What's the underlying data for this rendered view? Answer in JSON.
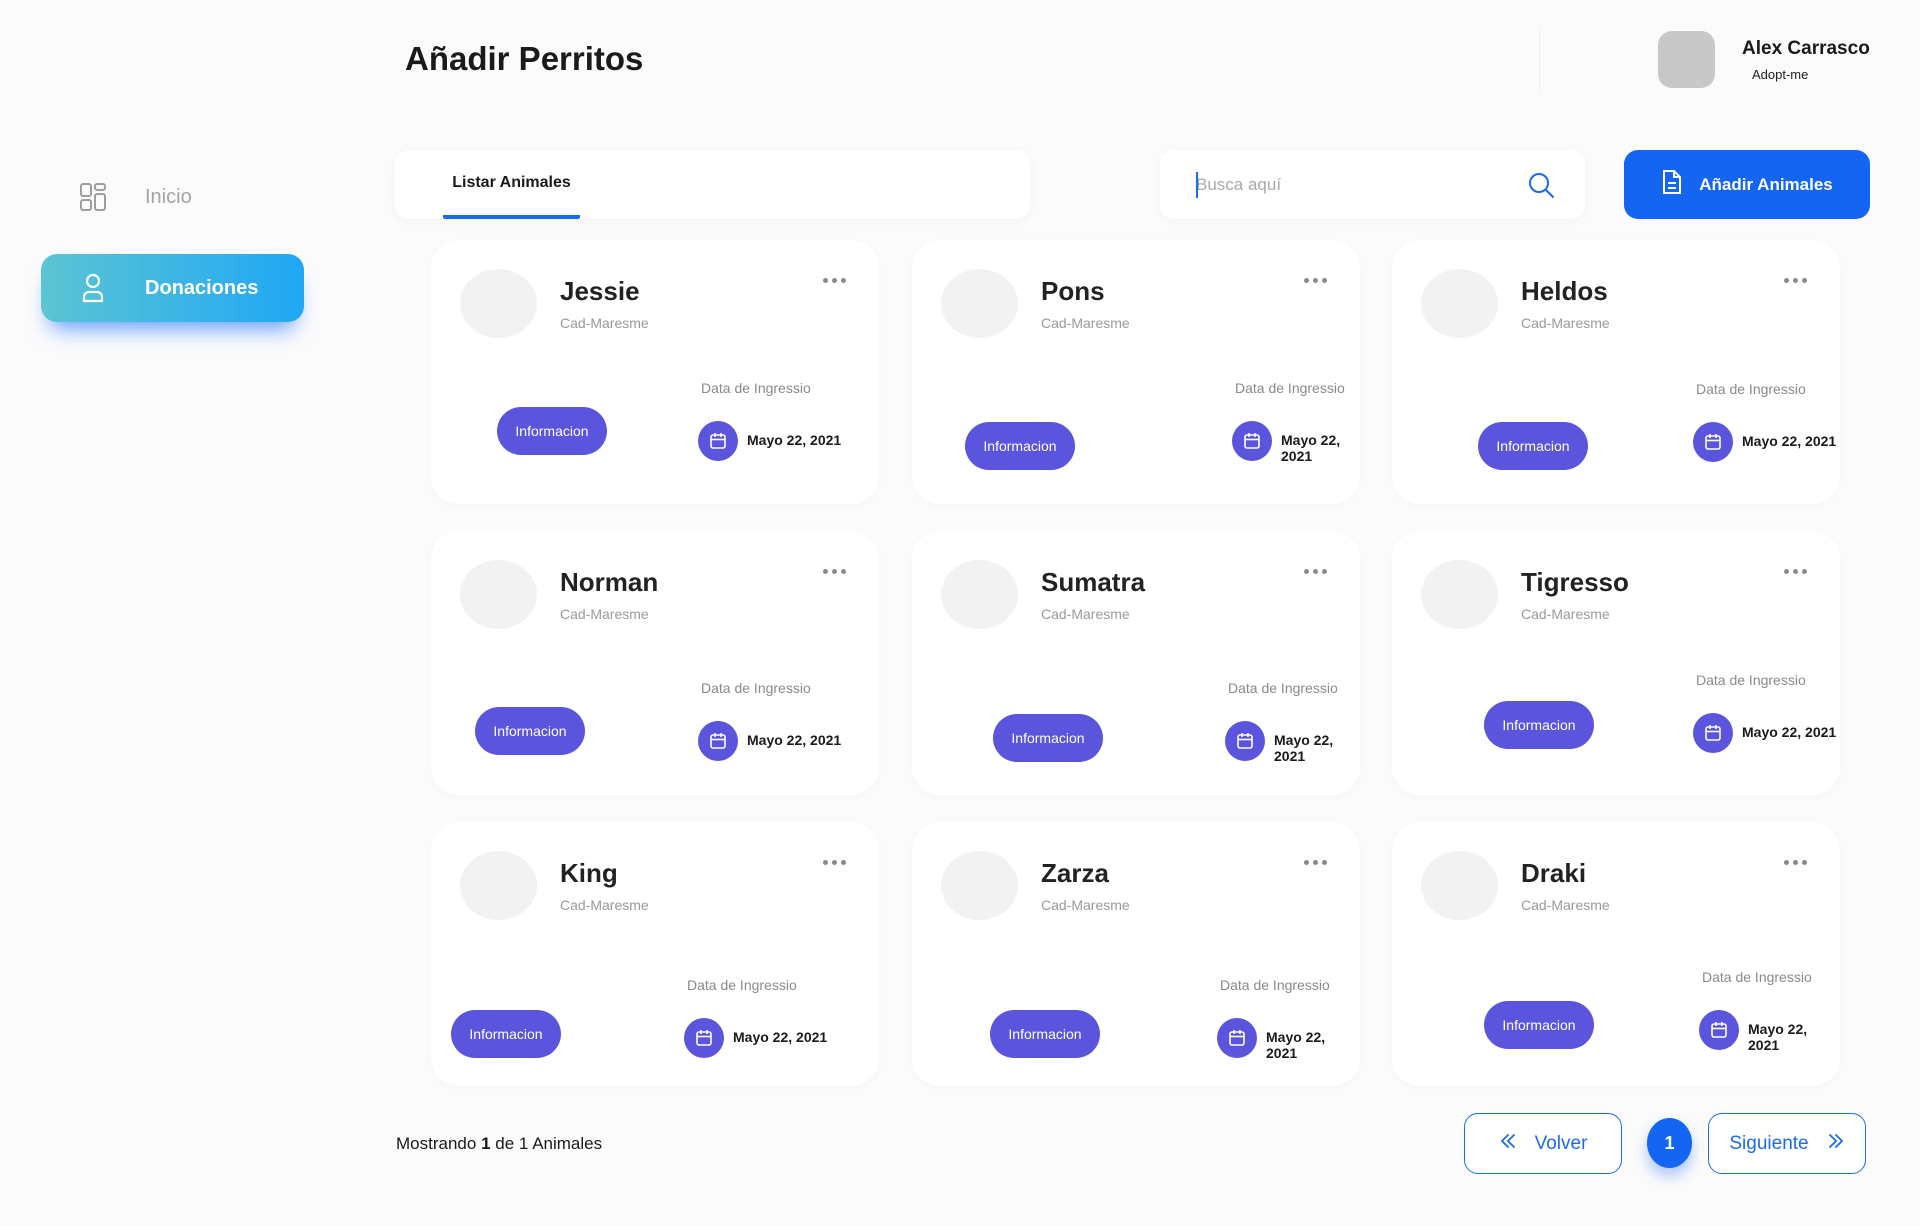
{
  "header": {
    "title": "Añadir Perritos",
    "user_name": "Alex Carrasco",
    "user_org": "Adopt-me"
  },
  "sidebar": {
    "items": [
      {
        "label": "Inicio",
        "icon": "dashboard-icon",
        "active": false
      },
      {
        "label": "Donaciones",
        "icon": "user-icon",
        "active": true
      }
    ]
  },
  "toolbar": {
    "tab_label": "Listar Animales",
    "search_placeholder": "Busca aquí",
    "add_label": "Añadir Animales"
  },
  "cards": [
    {
      "name": "Jessie",
      "location": "Cad-Maresme",
      "info_label": "Informacion",
      "date_label": "Data de Ingressio",
      "date": "Mayo 22, 2021"
    },
    {
      "name": "Pons",
      "location": "Cad-Maresme",
      "info_label": "Informacion",
      "date_label": "Data de Ingressio",
      "date": "Mayo 22, 2021"
    },
    {
      "name": "Heldos",
      "location": "Cad-Maresme",
      "info_label": "Informacion",
      "date_label": "Data de Ingressio",
      "date": "Mayo 22, 2021"
    },
    {
      "name": "Norman",
      "location": "Cad-Maresme",
      "info_label": "Informacion",
      "date_label": "Data de Ingressio",
      "date": "Mayo 22, 2021"
    },
    {
      "name": "Sumatra",
      "location": "Cad-Maresme",
      "info_label": "Informacion",
      "date_label": "Data de Ingressio",
      "date": "Mayo 22, 2021"
    },
    {
      "name": "Tigresso",
      "location": "Cad-Maresme",
      "info_label": "Informacion",
      "date_label": "Data de Ingressio",
      "date": "Mayo 22, 2021"
    },
    {
      "name": "King",
      "location": "Cad-Maresme",
      "info_label": "Informacion",
      "date_label": "Data de Ingressio",
      "date": "Mayo 22, 2021"
    },
    {
      "name": "Zarza",
      "location": "Cad-Maresme",
      "info_label": "Informacion",
      "date_label": "Data de Ingressio",
      "date": "Mayo 22, 2021"
    },
    {
      "name": "Draki",
      "location": "Cad-Maresme",
      "info_label": "Informacion",
      "date_label": "Data de Ingressio",
      "date": "Mayo 22, 2021"
    }
  ],
  "footer": {
    "showing_prefix": "Mostrando",
    "showing_count": "1",
    "showing_middle": "de",
    "showing_total": "1",
    "showing_suffix": "Animales",
    "prev_label": "Volver",
    "current_page": "1",
    "next_label": "Siguiente"
  },
  "colors": {
    "primary": "#1365f2",
    "accent": "#5b54dc",
    "sidebar_gradient_start": "#5cc4d3",
    "sidebar_gradient_end": "#1fa8f5"
  }
}
